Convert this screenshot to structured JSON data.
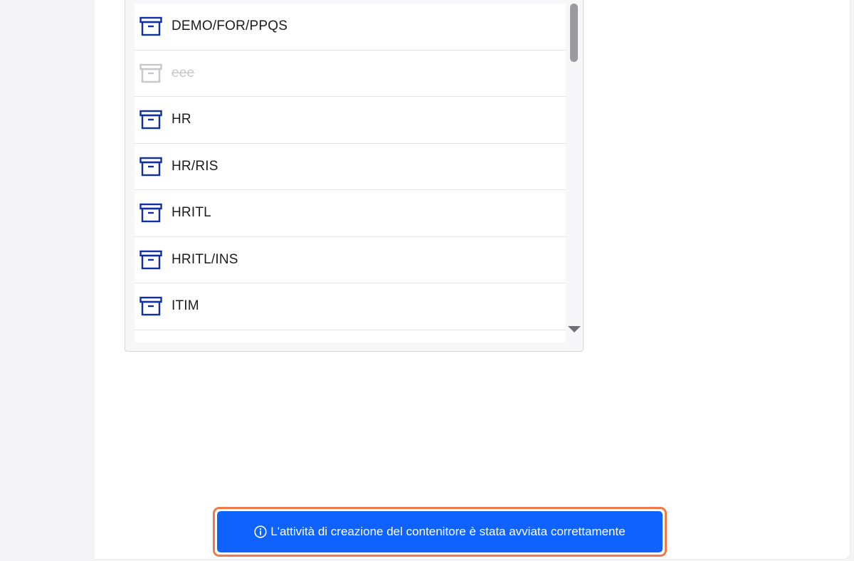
{
  "listbox": {
    "items": [
      {
        "label": "DEMO/FOR/PPQS",
        "icon": "archive-box-icon",
        "disabled": false
      },
      {
        "label": "eee",
        "icon": "archive-box-icon",
        "disabled": true
      },
      {
        "label": "HR",
        "icon": "archive-box-icon",
        "disabled": false
      },
      {
        "label": "HR/RIS",
        "icon": "archive-box-icon",
        "disabled": false
      },
      {
        "label": "HRITL",
        "icon": "archive-box-icon",
        "disabled": false
      },
      {
        "label": "HRITL/INS",
        "icon": "archive-box-icon",
        "disabled": false
      },
      {
        "label": "ITIM",
        "icon": "archive-box-icon",
        "disabled": false
      }
    ]
  },
  "toast": {
    "icon": "info-icon",
    "message": "L'attività di creazione del contenitore è stata avviata correttamente"
  },
  "colors": {
    "icon_active": "#0f2fa3",
    "icon_disabled": "#c8c8cc",
    "toast_background": "#0f62fe",
    "toast_highlight": "#f0784a"
  }
}
